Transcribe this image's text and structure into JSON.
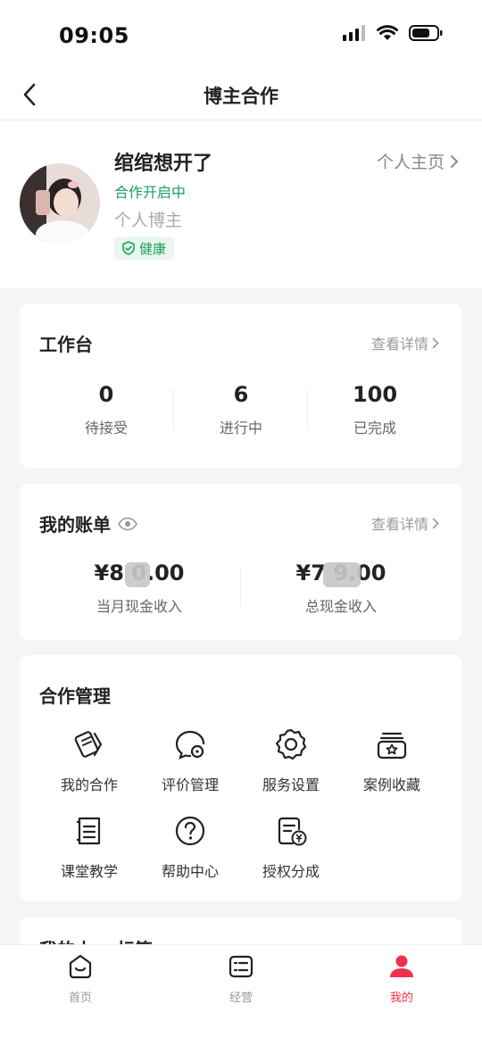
{
  "status_bar": {
    "time": "09:05"
  },
  "nav": {
    "title": "博主合作"
  },
  "profile": {
    "name": "绾绾想开了",
    "status": "合作开启中",
    "type": "个人博主",
    "health": "健康",
    "homepage_link": "个人主页"
  },
  "workbench": {
    "title": "工作台",
    "more": "查看详情",
    "stats": [
      {
        "value": "0",
        "label": "待接受"
      },
      {
        "value": "6",
        "label": "进行中"
      },
      {
        "value": "100",
        "label": "已完成"
      }
    ]
  },
  "bill": {
    "title": "我的账单",
    "more": "查看详情",
    "items": [
      {
        "amount": "¥8  0.00",
        "label": "当月现金收入"
      },
      {
        "amount": "¥7  9.00",
        "label": "总现金收入"
      }
    ]
  },
  "management": {
    "title": "合作管理",
    "items": [
      {
        "label": "我的合作",
        "icon": "coop-icon"
      },
      {
        "label": "评价管理",
        "icon": "review-icon"
      },
      {
        "label": "服务设置",
        "icon": "gear-icon"
      },
      {
        "label": "案例收藏",
        "icon": "star-box-icon"
      },
      {
        "label": "课堂教学",
        "icon": "book-icon"
      },
      {
        "label": "帮助中心",
        "icon": "help-icon"
      },
      {
        "label": "授权分成",
        "icon": "revenue-doc-icon"
      }
    ]
  },
  "next_section": {
    "title": "我的十… 标签"
  },
  "tabbar": {
    "items": [
      {
        "label": "首页",
        "icon": "home-icon"
      },
      {
        "label": "经营",
        "icon": "list-icon"
      },
      {
        "label": "我的",
        "icon": "user-icon"
      }
    ]
  },
  "colors": {
    "accent_green": "#1aa05a",
    "accent_red": "#f0304a"
  }
}
